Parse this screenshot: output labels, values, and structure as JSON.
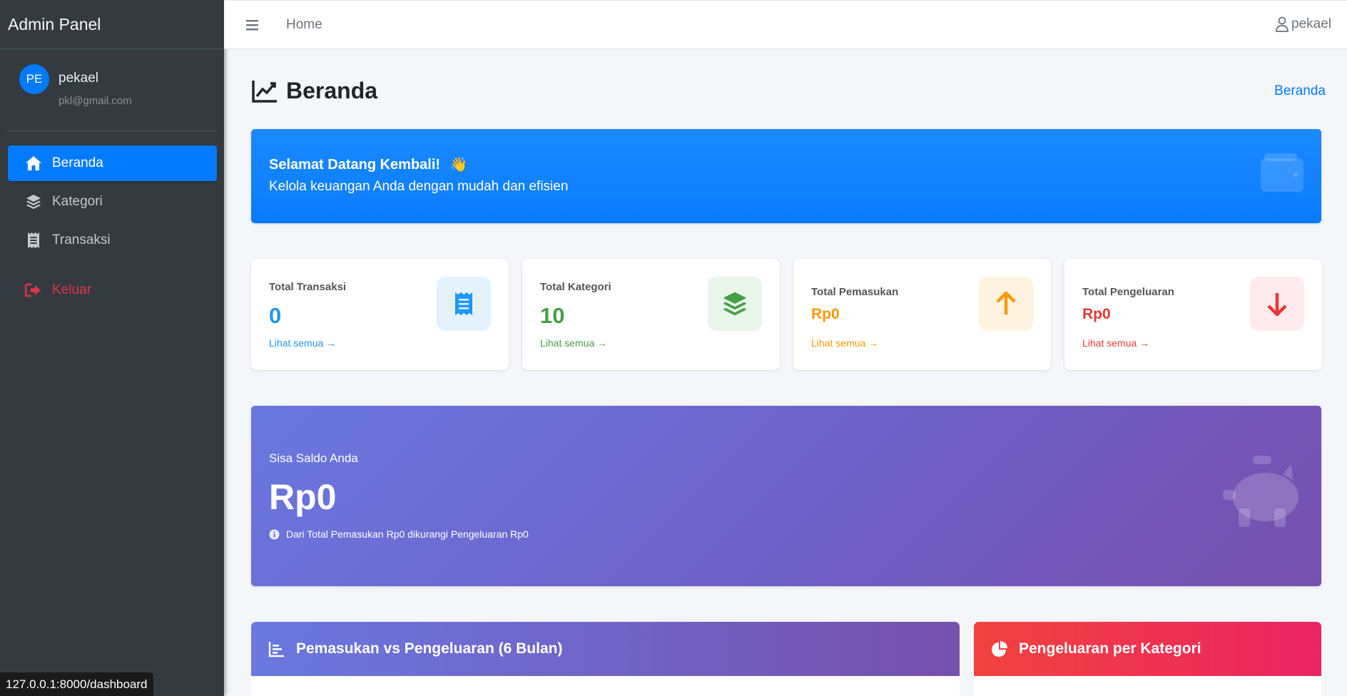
{
  "sidebar": {
    "brand": "Admin Panel",
    "user": {
      "initials": "PE",
      "name": "pekael",
      "email": "pkl@gmail.com"
    },
    "items": [
      {
        "label": "Beranda",
        "icon": "home-icon",
        "active": true
      },
      {
        "label": "Kategori",
        "icon": "layers-icon",
        "active": false
      },
      {
        "label": "Transaksi",
        "icon": "receipt-icon",
        "active": false
      }
    ],
    "logout": {
      "label": "Keluar",
      "icon": "logout-icon"
    }
  },
  "topbar": {
    "home": "Home",
    "user": "pekael"
  },
  "page": {
    "title": "Beranda",
    "breadcrumb": "Beranda"
  },
  "welcome": {
    "title": "Selamat Datang Kembali!",
    "emoji": "👋",
    "subtitle": "Kelola keuangan Anda dengan mudah dan efisien"
  },
  "stats": [
    {
      "label": "Total Transaksi",
      "value": "0",
      "link": "Lihat semua →",
      "color": "#2196f3",
      "bg": "#e3f2fd",
      "icon": "receipt-icon"
    },
    {
      "label": "Total Kategori",
      "value": "10",
      "link": "Lihat semua →",
      "color": "#43a047",
      "bg": "#e8f5e9",
      "icon": "layers-icon"
    },
    {
      "label": "Total Pemasukan",
      "value": "Rp0",
      "link": "Lihat semua →",
      "color": "#ff9800",
      "bg": "#fff3e0",
      "icon": "arrow-up-icon"
    },
    {
      "label": "Total Pengeluaran",
      "value": "Rp0",
      "link": "Lihat semua →",
      "color": "#e53935",
      "bg": "#ffebee",
      "icon": "arrow-down-icon"
    }
  ],
  "saldo": {
    "label": "Sisa Saldo Anda",
    "value": "Rp0",
    "note": "Dari Total Pemasukan Rp0 dikurangi Pengeluaran Rp0"
  },
  "panels": [
    {
      "title": "Pemasukan vs Pengeluaran (6 Bulan)",
      "icon": "bar-chart-icon"
    },
    {
      "title": "Pengeluaran per Kategori",
      "icon": "pie-chart-icon"
    }
  ],
  "status_bar": {
    "url": "127.0.0.1:8000/dashboard"
  },
  "colors": {
    "primary": "#007bff",
    "sidebar": "#343a40",
    "danger": "#dc3545"
  }
}
